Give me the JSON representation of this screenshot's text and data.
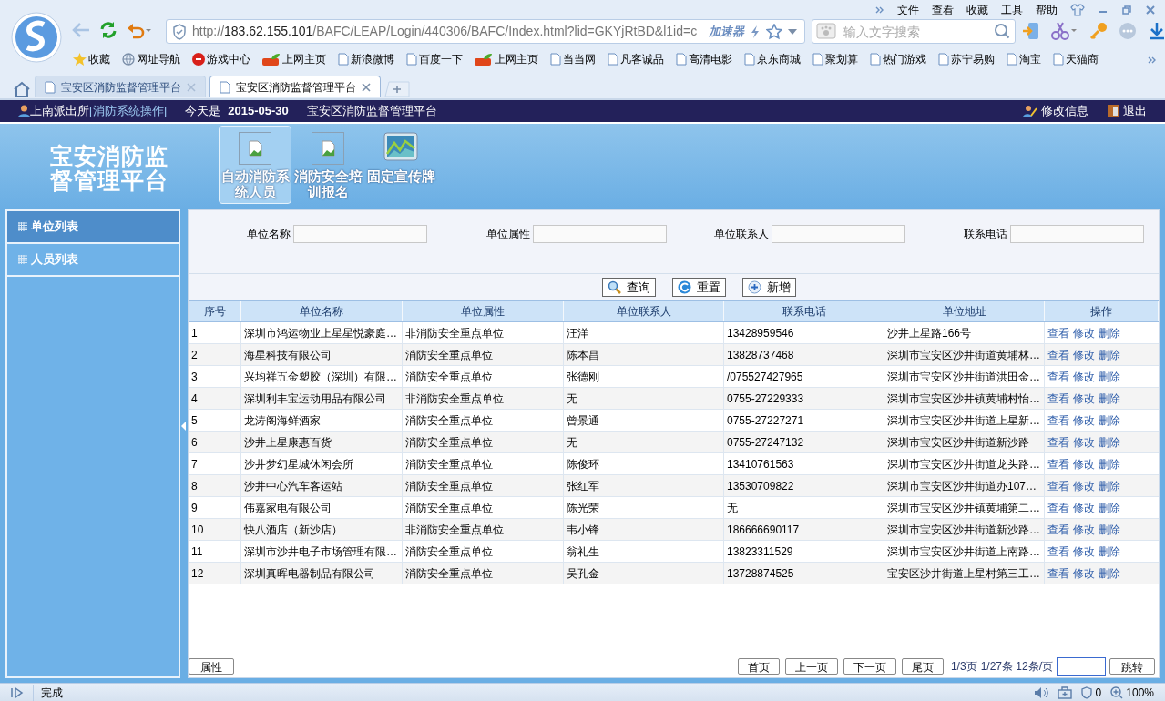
{
  "browser": {
    "menu": [
      "文件",
      "查看",
      "收藏",
      "工具",
      "帮助"
    ],
    "url": {
      "scheme": "http://",
      "host": "183.62.155.101",
      "path": "/BAFC/LEAP/Login/440306/BAFC/Index.html?lid=GKYjRtBD&l1id=c"
    },
    "accelerator": "加速器",
    "search": {
      "placeholder": "输入文字搜索"
    },
    "bookmarks": [
      {
        "label": "收藏",
        "kind": "star"
      },
      {
        "label": "网址导航",
        "kind": "globe"
      },
      {
        "label": "游戏中心",
        "kind": "game"
      },
      {
        "label": "上网主页",
        "kind": "hao"
      },
      {
        "label": "新浪微博",
        "kind": "page"
      },
      {
        "label": "百度一下",
        "kind": "page"
      },
      {
        "label": "上网主页",
        "kind": "hao"
      },
      {
        "label": "当当网",
        "kind": "page"
      },
      {
        "label": "凡客诚品",
        "kind": "page"
      },
      {
        "label": "高清电影",
        "kind": "page"
      },
      {
        "label": "京东商城",
        "kind": "page"
      },
      {
        "label": "聚划算",
        "kind": "page"
      },
      {
        "label": "热门游戏",
        "kind": "page"
      },
      {
        "label": "苏宁易购",
        "kind": "page"
      },
      {
        "label": "淘宝",
        "kind": "page"
      },
      {
        "label": "天猫商",
        "kind": "page"
      }
    ],
    "tabs": [
      {
        "label": "宝安区消防监督管理平台",
        "selected": false
      },
      {
        "label": "宝安区消防监督管理平台",
        "selected": true
      }
    ]
  },
  "header": {
    "user": "上南派出所",
    "role": "[消防系统操作]",
    "date_label": "今天是",
    "date": "2015-05-30",
    "title": "宝安区消防监督管理平台",
    "actions": [
      {
        "label": "修改信息",
        "kind": "edit"
      },
      {
        "label": "退出",
        "kind": "exit"
      }
    ]
  },
  "banner": {
    "logo_lines": [
      "宝安消防监",
      "督管理平台"
    ],
    "nav": [
      {
        "label": "自动消防系统人员",
        "kind": "broken",
        "selected": true
      },
      {
        "label": "消防安全培训报名",
        "kind": "broken",
        "selected": false
      },
      {
        "label": "固定宣传牌",
        "kind": "chart",
        "selected": false
      }
    ]
  },
  "sidebar": {
    "items": [
      {
        "label": "单位列表",
        "selected": true
      },
      {
        "label": "人员列表",
        "selected": false
      }
    ]
  },
  "filters": [
    {
      "label": "单位名称"
    },
    {
      "label": "单位属性"
    },
    {
      "label": "单位联系人"
    },
    {
      "label": "联系电话"
    }
  ],
  "buttons": [
    {
      "label": "查询",
      "kind": "search"
    },
    {
      "label": "重置",
      "kind": "reset"
    },
    {
      "label": "新增",
      "kind": "add"
    }
  ],
  "table": {
    "columns": [
      "序号",
      "单位名称",
      "单位属性",
      "单位联系人",
      "联系电话",
      "单位地址",
      "操作"
    ],
    "rows": [
      [
        "1",
        "深圳市鸿运物业上星星悦豪庭…",
        "非消防安全重点单位",
        "汪洋",
        "13428959546",
        "沙井上星路166号"
      ],
      [
        "2",
        "海星科技有限公司",
        "消防安全重点单位",
        "陈本昌",
        "13828737468",
        "深圳市宝安区沙井街道黄埔林…"
      ],
      [
        "3",
        "兴均祥五金塑胶（深圳）有限…",
        "消防安全重点单位",
        "张德刚",
        "/075527427965",
        "深圳市宝安区沙井街道洪田金…"
      ],
      [
        "4",
        "深圳利丰宝运动用品有限公司",
        "非消防安全重点单位",
        "无",
        "0755-27229333",
        "深圳市宝安区沙井镇黄埔村怡…"
      ],
      [
        "5",
        "龙涛阁海鲜酒家",
        "消防安全重点单位",
        "曾景通",
        "0755-27227271",
        "深圳市宝安区沙井街道上星新…"
      ],
      [
        "6",
        "沙井上星康惠百货",
        "消防安全重点单位",
        "无",
        "0755-27247132",
        "深圳市宝安区沙井街道新沙路"
      ],
      [
        "7",
        "沙井梦幻星城休闲会所",
        "消防安全重点单位",
        "陈俊环",
        "13410761563",
        "深圳市宝安区沙井街道龙头路…"
      ],
      [
        "8",
        "沙井中心汽车客运站",
        "消防安全重点单位",
        "张红军",
        "13530709822",
        "深圳市宝安区沙井街道办107…"
      ],
      [
        "9",
        "伟嘉家电有限公司",
        "消防安全重点单位",
        "陈光荣",
        "无",
        "深圳市宝安区沙井镇黄埔第二…"
      ],
      [
        "10",
        "快八酒店（新沙店）",
        "非消防安全重点单位",
        "韦小锋",
        "186666690117",
        "深圳市宝安区沙井街道新沙路…"
      ],
      [
        "11",
        "深圳市沙井电子市场管理有限…",
        "消防安全重点单位",
        "翁礼生",
        "13823311529",
        "深圳市宝安区沙井街道上南路…"
      ],
      [
        "12",
        "深圳真晖电器制品有限公司",
        "消防安全重点单位",
        "吴孔金",
        "13728874525",
        "宝安区沙井街道上星村第三工…"
      ]
    ],
    "row_actions": [
      [
        "查看",
        "修改",
        "删除"
      ],
      [
        "查看",
        "修改",
        "删除"
      ],
      [
        "查看",
        "修改",
        "删除"
      ],
      [
        "查看",
        "修改",
        "删除"
      ],
      [
        "查看",
        "修改",
        "删除"
      ],
      [
        "查看",
        "修改",
        "删除"
      ],
      [
        "查看",
        "修改",
        "删除"
      ],
      [
        "查看",
        "修改",
        "删除"
      ],
      [
        "查看",
        "修改",
        "删除"
      ],
      [
        "查看",
        "修改",
        "删除"
      ],
      [
        "查看",
        "修改",
        "删除"
      ],
      [
        "查看",
        "修改",
        "删除"
      ]
    ]
  },
  "footer": {
    "properties_button": "属性",
    "pager": [
      "首页",
      "上一页",
      "下一页",
      "尾页"
    ],
    "page_info": "1/3页",
    "count_info": "1/27条 12条/页",
    "jump_button": "跳转"
  },
  "status_bar": {
    "text": "完成",
    "ad_count": "0",
    "zoom": "100%"
  }
}
